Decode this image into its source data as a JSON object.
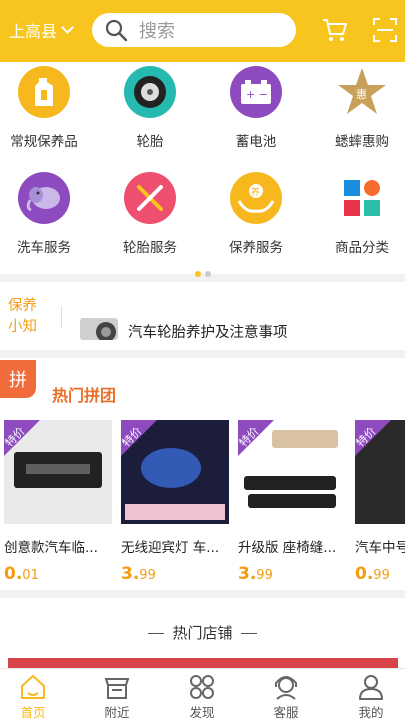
{
  "header": {
    "location": "上高县",
    "search_placeholder": "搜索"
  },
  "categories": [
    {
      "label": "常规保养品",
      "icon": "oil-bottle-icon"
    },
    {
      "label": "轮胎",
      "icon": "tire-icon"
    },
    {
      "label": "蓄电池",
      "icon": "battery-icon"
    },
    {
      "label": "蟋蟀惠购",
      "icon": "star-discount-icon",
      "badge": "惠"
    },
    {
      "label": "洗车服务",
      "icon": "elephant-icon"
    },
    {
      "label": "轮胎服务",
      "icon": "tools-icon"
    },
    {
      "label": "保养服务",
      "icon": "hands-care-icon",
      "badge": "养"
    },
    {
      "label": "商品分类",
      "icon": "grid-category-icon"
    }
  ],
  "news": {
    "tag_line1": "保养",
    "tag_line2": "小知",
    "title": "汽车轮胎养护及注意事项"
  },
  "group_buy": {
    "badge": "拼",
    "title": "热门拼团",
    "tag": "特价",
    "products": [
      {
        "name": "创意款汽车临...",
        "price_int": "0.",
        "price_dec": "01"
      },
      {
        "name": "无线迎宾灯 车...",
        "price_int": "3.",
        "price_dec": "99"
      },
      {
        "name": "升级版 座椅缝...",
        "price_int": "3.",
        "price_dec": "99"
      },
      {
        "name": "汽车中号",
        "price_int": "0.",
        "price_dec": "99"
      }
    ]
  },
  "shops": {
    "title": "热门店铺"
  },
  "nav": [
    {
      "label": "首页",
      "active": true
    },
    {
      "label": "附近",
      "active": false
    },
    {
      "label": "发现",
      "active": false
    },
    {
      "label": "客服",
      "active": false
    },
    {
      "label": "我的",
      "active": false
    }
  ],
  "colors": {
    "brand_yellow": "#f7c51e",
    "price_orange": "#f39c12",
    "tag_purple": "#8e4bc0"
  }
}
